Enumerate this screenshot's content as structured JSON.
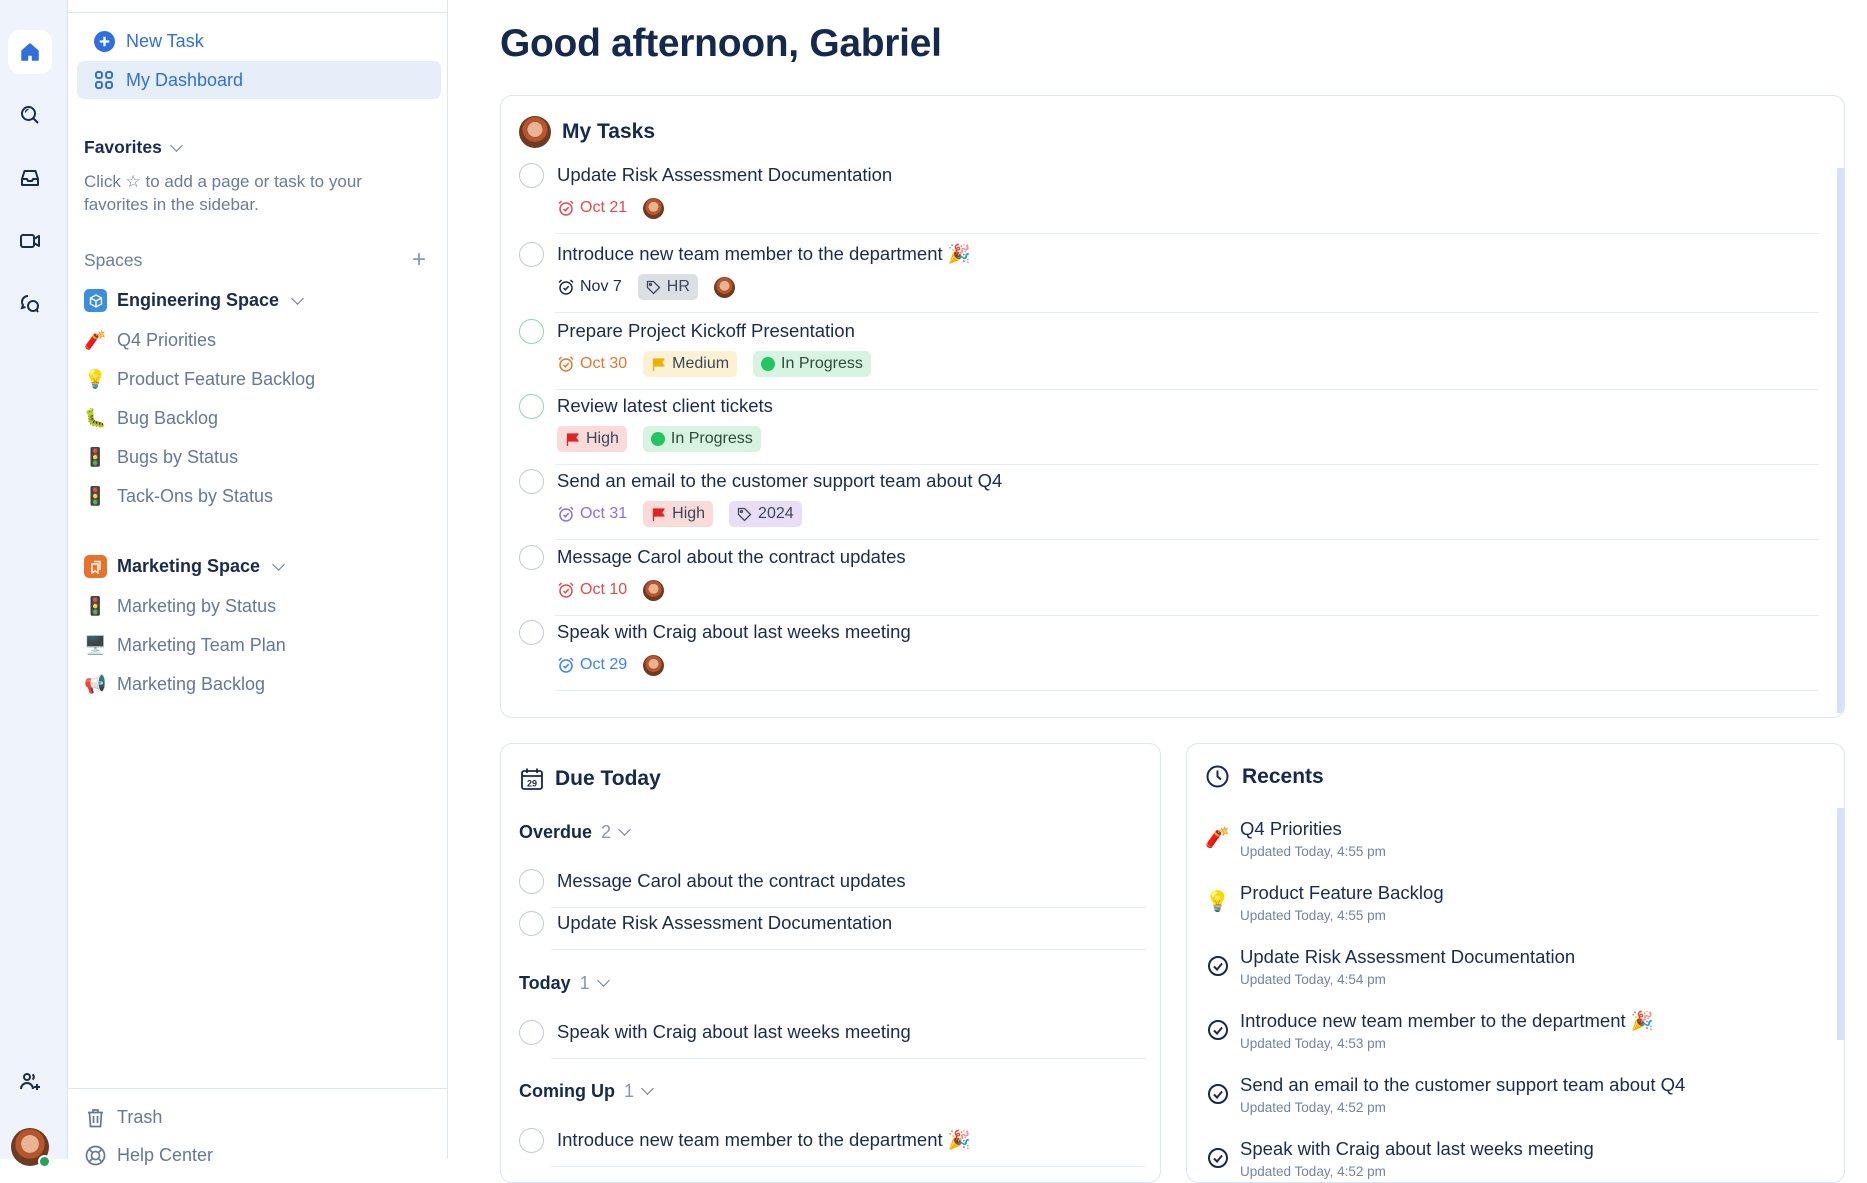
{
  "rail": {
    "items": [
      {
        "icon": "home-icon",
        "active": true
      },
      {
        "icon": "search-icon"
      },
      {
        "icon": "inbox-icon"
      },
      {
        "icon": "video-icon"
      },
      {
        "icon": "chat-icon"
      }
    ],
    "bottom": [
      {
        "icon": "add-user-icon"
      }
    ],
    "user_online": true
  },
  "sidebar": {
    "new_task": "New Task",
    "my_dashboard": "My Dashboard",
    "favorites": {
      "label": "Favorites",
      "hint": "Click ☆ to add a page or task to your favorites in the sidebar."
    },
    "spaces_label": "Spaces",
    "spaces": [
      {
        "name": "Engineering Space",
        "color": "#3b8de0",
        "items": [
          {
            "emoji": "🧨",
            "label": "Q4 Priorities"
          },
          {
            "emoji": "💡",
            "label": "Product Feature Backlog"
          },
          {
            "emoji": "🐛",
            "label": "Bug Backlog"
          },
          {
            "emoji": "🚦",
            "label": "Bugs by Status"
          },
          {
            "emoji": "🚦",
            "label": "Tack-Ons by Status"
          }
        ]
      },
      {
        "name": "Marketing Space",
        "color": "#e8712b",
        "items": [
          {
            "emoji": "🚦",
            "label": "Marketing by Status"
          },
          {
            "emoji": "🖥️",
            "label": "Marketing Team Plan"
          },
          {
            "emoji": "📢",
            "label": "Marketing Backlog"
          }
        ]
      }
    ],
    "trash": "Trash",
    "help_center": "Help Center"
  },
  "main": {
    "greeting": "Good afternoon, Gabriel",
    "my_tasks": {
      "title": "My Tasks",
      "tasks": [
        {
          "name": "Update Risk Assessment Documentation",
          "status": "open",
          "due": "Oct 21",
          "due_color": "#e5484d",
          "tags": [],
          "assignee": true
        },
        {
          "name": "Introduce new team member to the department 🎉",
          "status": "open",
          "due": "Nov 7",
          "due_color": "#1b2b4e",
          "tags": [
            {
              "label": "HR",
              "kind": "tag",
              "bg": "#dcdfe4",
              "fg": "#3a4660"
            }
          ],
          "assignee": true
        },
        {
          "name": "Prepare Project Kickoff Presentation",
          "status": "in-progress",
          "due": "Oct 30",
          "due_color": "#e07a2f",
          "tags": [
            {
              "label": "Medium",
              "kind": "flag",
              "bg": "#fcf1d2",
              "fg": "#3a4660",
              "icon_color": "#eab308"
            },
            {
              "label": "In Progress",
              "kind": "status",
              "bg": "#d9f3e3",
              "fg": "#2f4a3a"
            }
          ],
          "assignee": false
        },
        {
          "name": "Review latest client tickets",
          "status": "in-progress",
          "due": null,
          "tags": [
            {
              "label": "High",
              "kind": "flag",
              "bg": "#fbdada",
              "fg": "#3a4660",
              "icon_color": "#e02424"
            },
            {
              "label": "In Progress",
              "kind": "status",
              "bg": "#d9f3e3",
              "fg": "#2f4a3a"
            }
          ],
          "assignee": false
        },
        {
          "name": "Send an email to the customer support team about Q4",
          "status": "open",
          "due": "Oct 31",
          "due_color": "#8b6fe0",
          "tags": [
            {
              "label": "High",
              "kind": "flag",
              "bg": "#fbdada",
              "fg": "#3a4660",
              "icon_color": "#e02424"
            },
            {
              "label": "2024",
              "kind": "tag",
              "bg": "#e8defa",
              "fg": "#3a4660"
            }
          ],
          "assignee": false
        },
        {
          "name": "Message Carol about the contract updates",
          "status": "open",
          "due": "Oct 10",
          "due_color": "#e5484d",
          "tags": [],
          "assignee": true
        },
        {
          "name": "Speak with Craig about last weeks meeting",
          "status": "open",
          "due": "Oct 29",
          "due_color": "#3b82f6",
          "tags": [],
          "assignee": true
        }
      ]
    },
    "due_today": {
      "title": "Due Today",
      "calendar_day": "29",
      "groups": [
        {
          "label": "Overdue",
          "count": "2",
          "tasks": [
            "Message Carol about the contract updates",
            "Update Risk Assessment Documentation"
          ]
        },
        {
          "label": "Today",
          "count": "1",
          "tasks": [
            "Speak with Craig about last weeks meeting"
          ]
        },
        {
          "label": "Coming Up",
          "count": "1",
          "tasks": [
            "Introduce new team member to the department 🎉"
          ]
        }
      ]
    },
    "recents": {
      "title": "Recents",
      "items": [
        {
          "icon": "emoji",
          "emoji": "🧨",
          "name": "Q4 Priorities",
          "updated": "Updated Today, 4:55 pm"
        },
        {
          "icon": "emoji",
          "emoji": "💡",
          "name": "Product Feature Backlog",
          "updated": "Updated Today, 4:55 pm"
        },
        {
          "icon": "task",
          "name": "Update Risk Assessment Documentation",
          "updated": "Updated Today, 4:54 pm"
        },
        {
          "icon": "task",
          "name": "Introduce new team member to the department 🎉",
          "updated": "Updated Today, 4:53 pm"
        },
        {
          "icon": "task",
          "name": "Send an email to the customer support team about Q4",
          "updated": "Updated Today, 4:52 pm"
        },
        {
          "icon": "task",
          "name": "Speak with Craig about last weeks meeting",
          "updated": "Updated Today, 4:52 pm"
        }
      ]
    }
  },
  "colors": {
    "accent": "#2f6fe0",
    "text": "#15294f",
    "muted": "#65779a",
    "rail_bg": "#eff4fc",
    "border": "#dbe5f3"
  }
}
